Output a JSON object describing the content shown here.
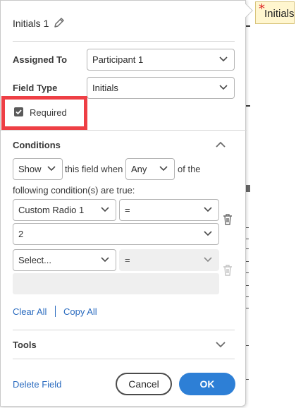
{
  "document": {
    "tag_field": {
      "label": "Initials",
      "required_mark": "*"
    }
  },
  "panel": {
    "title": "Initials 1",
    "edit_icon": "pencil-icon",
    "assigned_to": {
      "label": "Assigned To",
      "value": "Participant 1"
    },
    "field_type": {
      "label": "Field Type",
      "value": "Initials"
    },
    "required": {
      "label": "Required",
      "checked": true
    },
    "conditions": {
      "header": "Conditions",
      "expanded": true,
      "show_select": "Show",
      "text_this_field_when": "this field when",
      "match_select": "Any",
      "text_of_the": "of the",
      "text_following": "following condition(s) are true:",
      "rules": [
        {
          "field": "Custom Radio 1",
          "operator": "=",
          "value": "2"
        },
        {
          "field": "Select...",
          "operator": "=",
          "value": ""
        }
      ],
      "clear_all": "Clear All",
      "copy_all": "Copy All"
    },
    "tools": {
      "header": "Tools",
      "expanded": false
    },
    "footer": {
      "delete_field": "Delete Field",
      "cancel": "Cancel",
      "ok": "OK"
    }
  },
  "colors": {
    "accent_blue": "#2d7fd6",
    "link_blue": "#2a6bbf",
    "highlight_red": "#ee3f45"
  }
}
